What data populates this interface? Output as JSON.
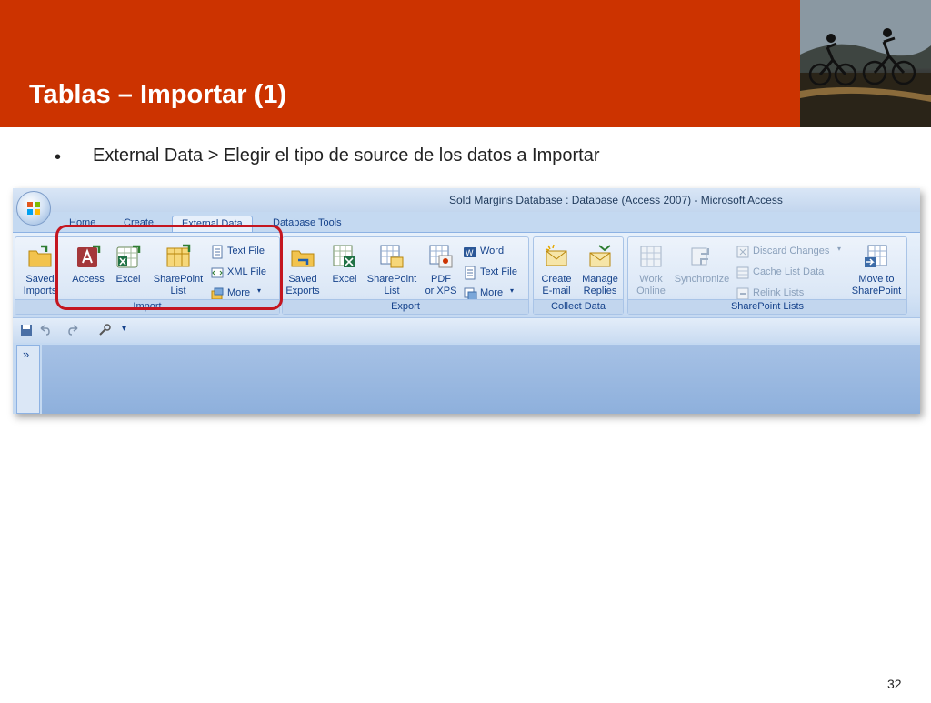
{
  "slide": {
    "title": "Tablas – Importar (1)",
    "bullet": "External Data > Elegir el tipo de source de los datos a Importar",
    "page_number": "32"
  },
  "window": {
    "title": "Sold Margins Database : Database (Access 2007) - Microsoft Access"
  },
  "tabs": [
    "Home",
    "Create",
    "External Data",
    "Database Tools"
  ],
  "active_tab": "External Data",
  "groups": {
    "import": {
      "label": "Import",
      "saved_imports": "Saved\nImports",
      "access": "Access",
      "excel": "Excel",
      "sharepoint_list": "SharePoint\nList",
      "text_file": "Text File",
      "xml_file": "XML File",
      "more": "More"
    },
    "export": {
      "label": "Export",
      "saved_exports": "Saved\nExports",
      "excel": "Excel",
      "sharepoint_list": "SharePoint\nList",
      "pdf_xps": "PDF\nor XPS",
      "word": "Word",
      "text_file": "Text File",
      "more": "More"
    },
    "collect": {
      "label": "Collect Data",
      "create_email": "Create\nE-mail",
      "manage_replies": "Manage\nReplies"
    },
    "sharepoint": {
      "label": "SharePoint Lists",
      "work_online": "Work\nOnline",
      "synchronize": "Synchronize",
      "discard_changes": "Discard Changes",
      "cache_list_data": "Cache List Data",
      "relink_lists": "Relink Lists",
      "move_to_sharepoint": "Move to\nSharePoint"
    }
  },
  "nav_pane": {
    "chevron": "»"
  },
  "colors": {
    "header": "#cc3300",
    "highlight": "#c41620",
    "ribbon_text": "#15428b"
  }
}
